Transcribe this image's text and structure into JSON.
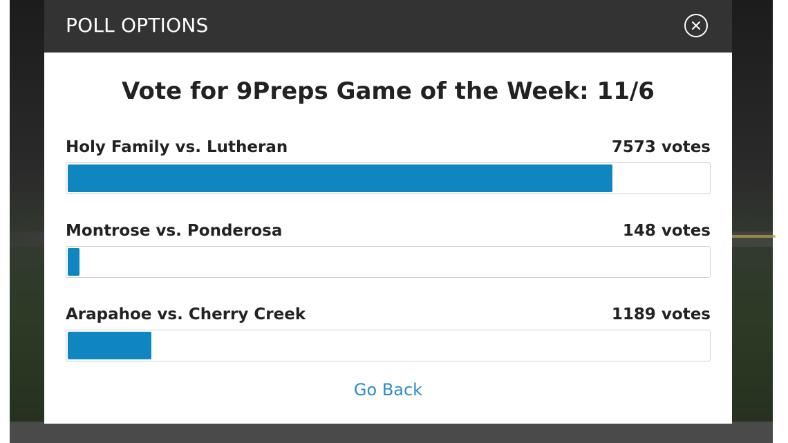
{
  "modal": {
    "header_title": "POLL OPTIONS",
    "close_icon": "close-icon"
  },
  "poll": {
    "title": "Vote for 9Preps Game of the Week: 11/6",
    "accent_color": "#0f86c0",
    "options": [
      {
        "label": "Holy Family vs. Lutheran",
        "votes": "7573 votes",
        "vote_count": 7573,
        "fill_fraction": 0.85
      },
      {
        "label": "Montrose vs. Ponderosa",
        "votes": "148 votes",
        "vote_count": 148,
        "fill_fraction": 0.018
      },
      {
        "label": "Arapahoe vs. Cherry Creek",
        "votes": "1189 votes",
        "vote_count": 1189,
        "fill_fraction": 0.13
      }
    ]
  },
  "footer": {
    "go_back_label": "Go Back",
    "link_color": "#2e8bc9"
  }
}
